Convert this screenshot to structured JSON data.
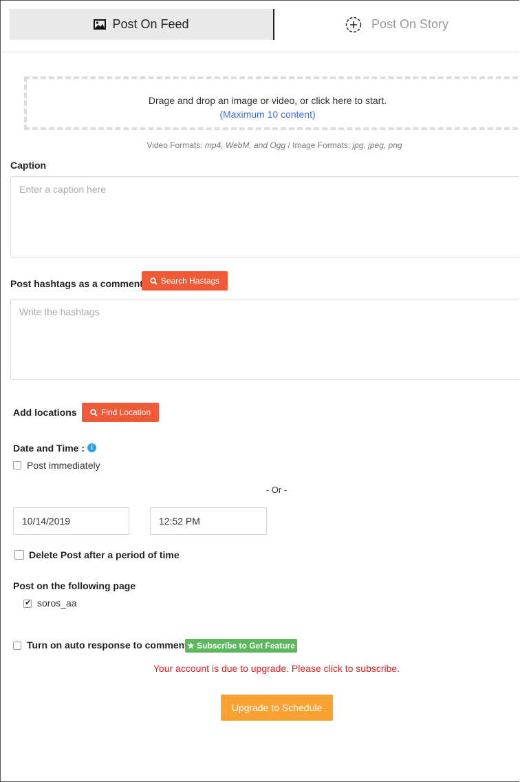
{
  "tabs": {
    "feed": {
      "label": "Post On Feed",
      "icon": "image-icon"
    },
    "story": {
      "label": "Post On Story",
      "icon": "add-circle-icon"
    }
  },
  "upload": {
    "instruction": "Drage and drop an image or video, or click here to start.",
    "limit": "(Maximum 10 content)",
    "video_formats_label": "Video Formats:",
    "video_formats": "mp4, WebM, and Ogg",
    "separator": "/",
    "image_formats_label": "Image Formats:",
    "image_formats": "jpg, jpeg, png"
  },
  "caption": {
    "label": "Caption",
    "placeholder": "Enter a caption here"
  },
  "hashtags": {
    "label": "Post hashtags as a comment",
    "search_button": "Search Hastags",
    "placeholder": "Write the hashtags"
  },
  "location": {
    "label": "Add locations",
    "find_button": "Find Location"
  },
  "schedule": {
    "label": "Date and Time :",
    "info_icon": "info-icon",
    "post_immediately": "Post immediately",
    "post_immediately_checked": false,
    "or_text": "- Or -",
    "date_value": "10/14/2019",
    "time_value": "12:52 PM",
    "delete_after_label": "Delete Post after a period of time",
    "delete_after_checked": false
  },
  "pages": {
    "label": "Post on the following page",
    "items": [
      {
        "name": "soros_aa",
        "checked": true
      }
    ]
  },
  "auto_response": {
    "label": "Turn on auto response to comments",
    "checked": false,
    "subscribe_badge": "★ Subscribe to Get Feature",
    "upgrade_warning": "Your account is due to upgrade. Please click to subscribe."
  },
  "submit": {
    "label": "Upgrade to Schedule"
  },
  "colors": {
    "red_button": "#f05a37",
    "orange_button": "#f9a232",
    "green_badge": "#5cb85c",
    "link_blue": "#3a6fd8",
    "warning_red": "#e02020",
    "info_blue": "#2fa0e0"
  }
}
